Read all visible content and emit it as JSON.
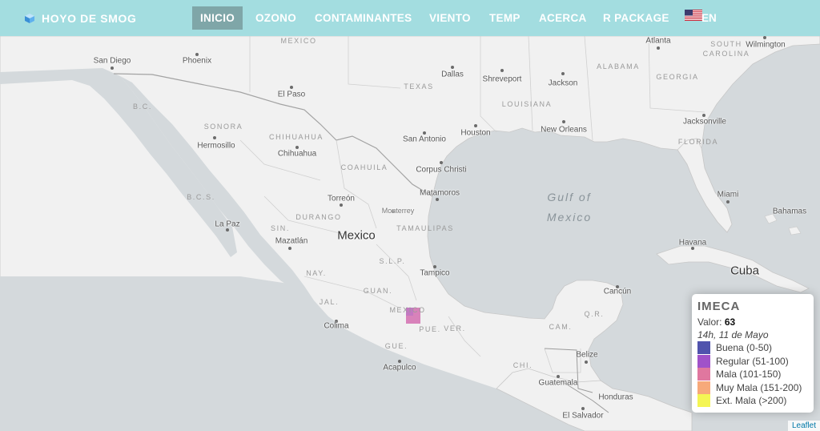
{
  "navbar": {
    "brand": "HOYO DE SMOG",
    "items": [
      "INICIO",
      "OZONO",
      "CONTAMINANTES",
      "VIENTO",
      "TEMP",
      "ACERCA",
      "R PACKAGE"
    ],
    "active": "INICIO",
    "language": "EN",
    "colors": {
      "background": "#a3dde0",
      "active": "#7fa6a8",
      "text": "#ffffff"
    }
  },
  "map": {
    "country_labels": [
      "Mexico",
      "Cuba"
    ],
    "sea_label": "Gulf of\nMexico",
    "region_labels": [
      "MEXICO",
      "TEXAS",
      "LOUISIANA",
      "ALABAMA",
      "GEORGIA",
      "SOUTH CAROLINA",
      "FLORIDA",
      "SONORA",
      "CHIHUAHUA",
      "COAHUILA",
      "DURANGO",
      "TAMAULIPAS",
      "B.C.",
      "B.C.S.",
      "SIN.",
      "NAY.",
      "JAL.",
      "GUAN.",
      "S.L.P.",
      "MEXICO",
      "PUE.",
      "GUE.",
      "VER.",
      "CAM.",
      "Q.R.",
      "CHI."
    ],
    "cities": [
      "San Diego",
      "Phoenix",
      "Atlanta",
      "Wilmington",
      "Dallas",
      "Shreveport",
      "Jackson",
      "El Paso",
      "New Orleans",
      "San Antonio",
      "Houston",
      "Jacksonville",
      "Hermosillo",
      "Chihuahua",
      "Corpus Christi",
      "Matamoros",
      "Torreón",
      "Miami",
      "Bahamas",
      "Monterrey",
      "La Paz",
      "Mazatlán",
      "Havana",
      "Tampico",
      "Cancún",
      "Colima",
      "Belize",
      "Acapulco",
      "Guatemala",
      "Honduras",
      "El Salvador"
    ],
    "pollution_marker_color": "#d46fb0",
    "colors": {
      "land": "#f1f1f1",
      "water": "#d4d9dc"
    }
  },
  "legend": {
    "title": "IMECA",
    "value_label": "Valor:",
    "value": "63",
    "timestamp": "14h, 11 de Mayo",
    "categories": [
      {
        "label": "Buena (0-50)",
        "color": "#5053ad"
      },
      {
        "label": "Regular (51-100)",
        "color": "#a052c9"
      },
      {
        "label": "Mala (101-150)",
        "color": "#e0779f"
      },
      {
        "label": "Muy Mala (151-200)",
        "color": "#f7a97a"
      },
      {
        "label": "Ext. Mala (>200)",
        "color": "#f4f554"
      }
    ]
  },
  "attribution": "Leaflet"
}
